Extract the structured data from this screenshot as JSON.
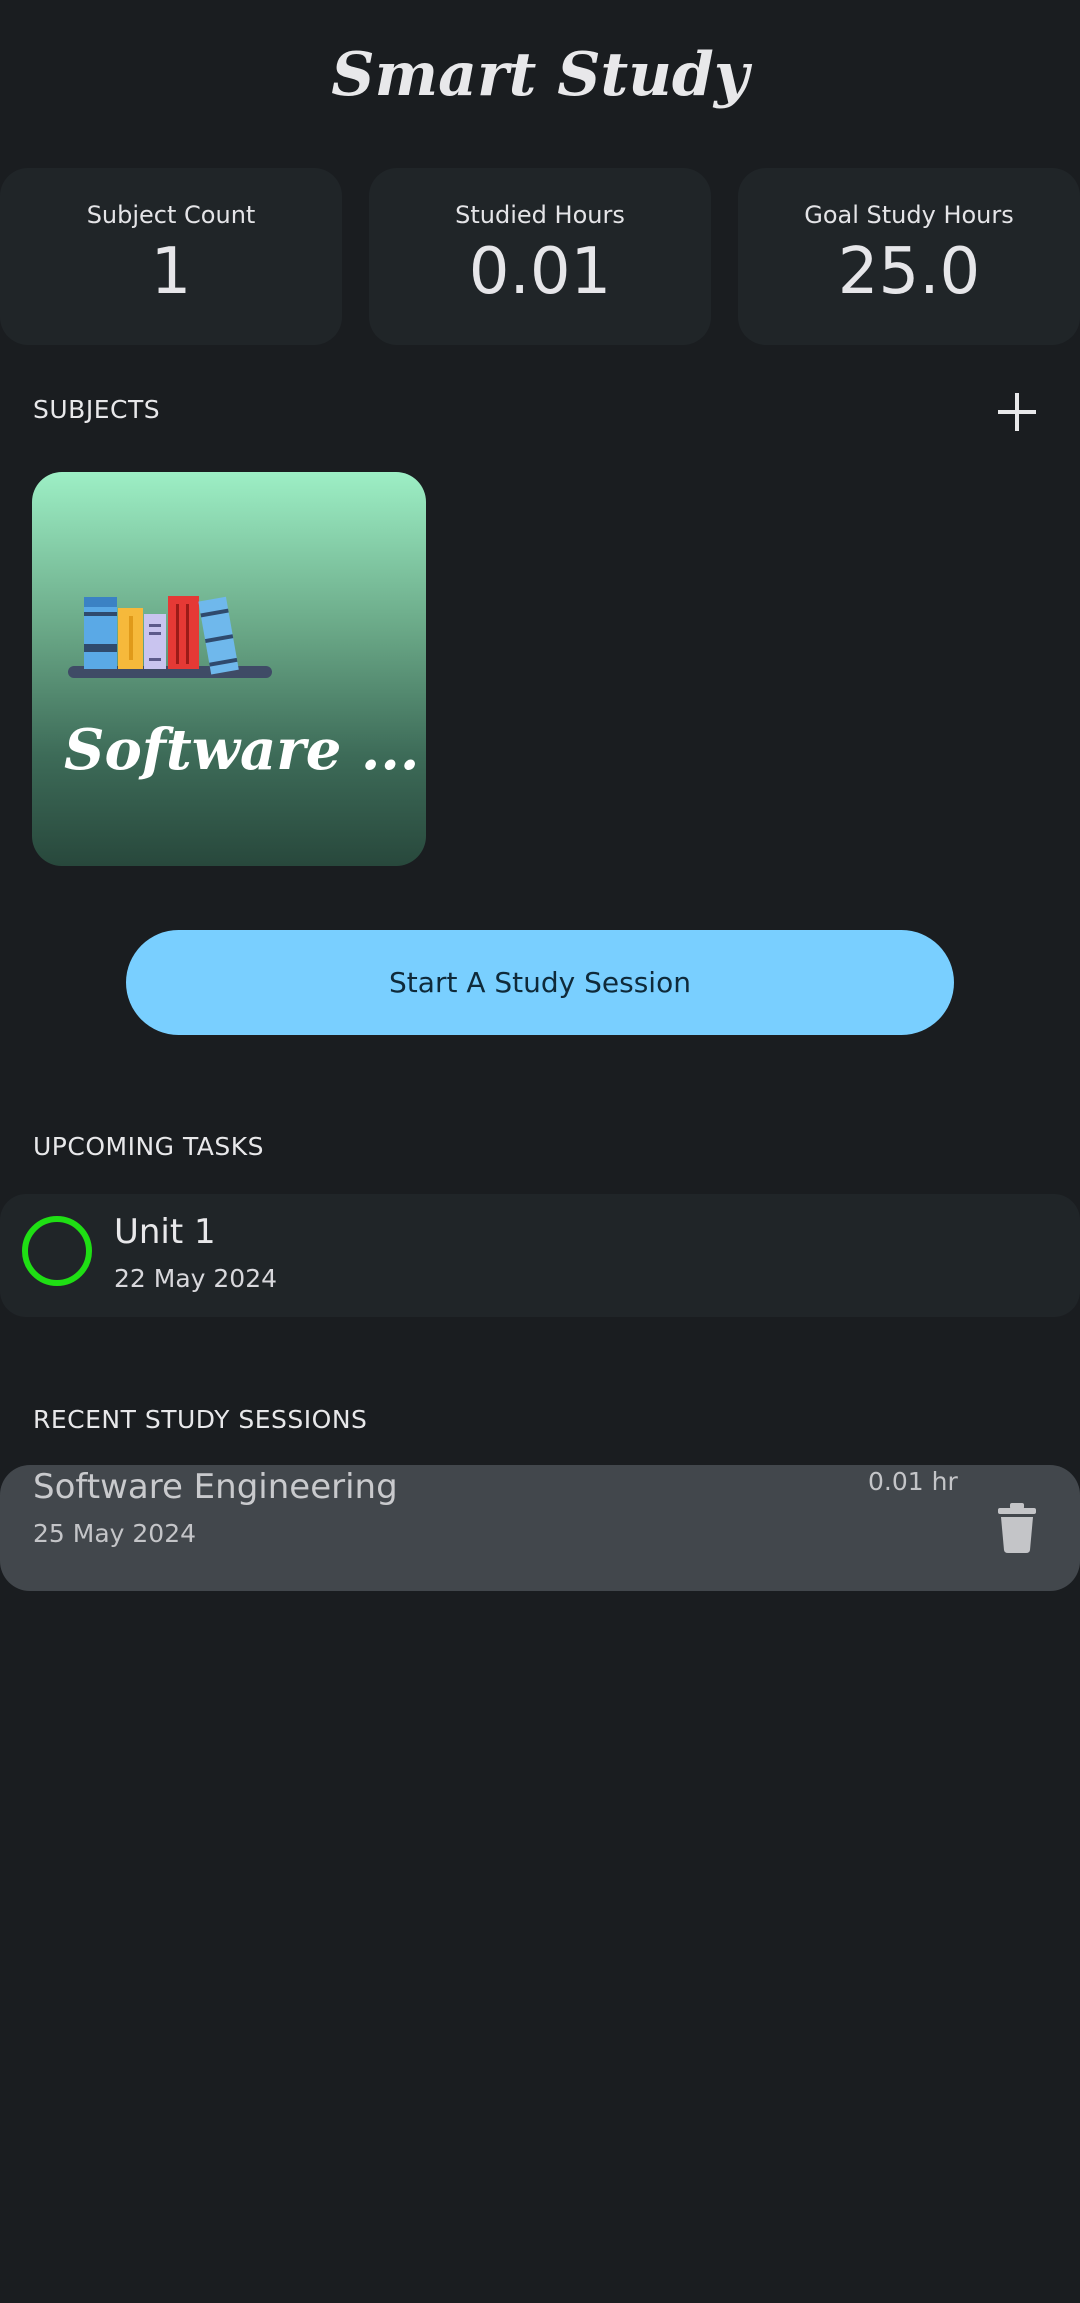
{
  "app": {
    "title": "Smart Study"
  },
  "stats": [
    {
      "label": "Subject Count",
      "value": "1"
    },
    {
      "label": "Studied Hours",
      "value": "0.01"
    },
    {
      "label": "Goal Study Hours",
      "value": "25.0"
    }
  ],
  "subjects": {
    "section_label": "SUBJECTS",
    "add_icon": "plus-icon",
    "items": [
      {
        "name": "Software ...",
        "image": "books-icon",
        "gradient_top": "#9defc5",
        "gradient_bottom": "#28483c"
      }
    ]
  },
  "start_button": {
    "label": "Start A Study Session",
    "color": "#79cfff"
  },
  "upcoming_tasks": {
    "section_label": "UPCOMING TASKS",
    "items": [
      {
        "title": "Unit 1",
        "date": "22 May 2024",
        "checkbox_color": "#1fdf14",
        "completed": false
      }
    ]
  },
  "recent_sessions": {
    "section_label": "RECENT STUDY SESSIONS",
    "items": [
      {
        "subject": "Software Engineering",
        "date": "25 May 2024",
        "duration": "0.01 hr",
        "action_icon": "trash-icon"
      }
    ]
  },
  "colors": {
    "background": "#1a1d20",
    "card": "#202528",
    "session_card": "#42474c"
  }
}
